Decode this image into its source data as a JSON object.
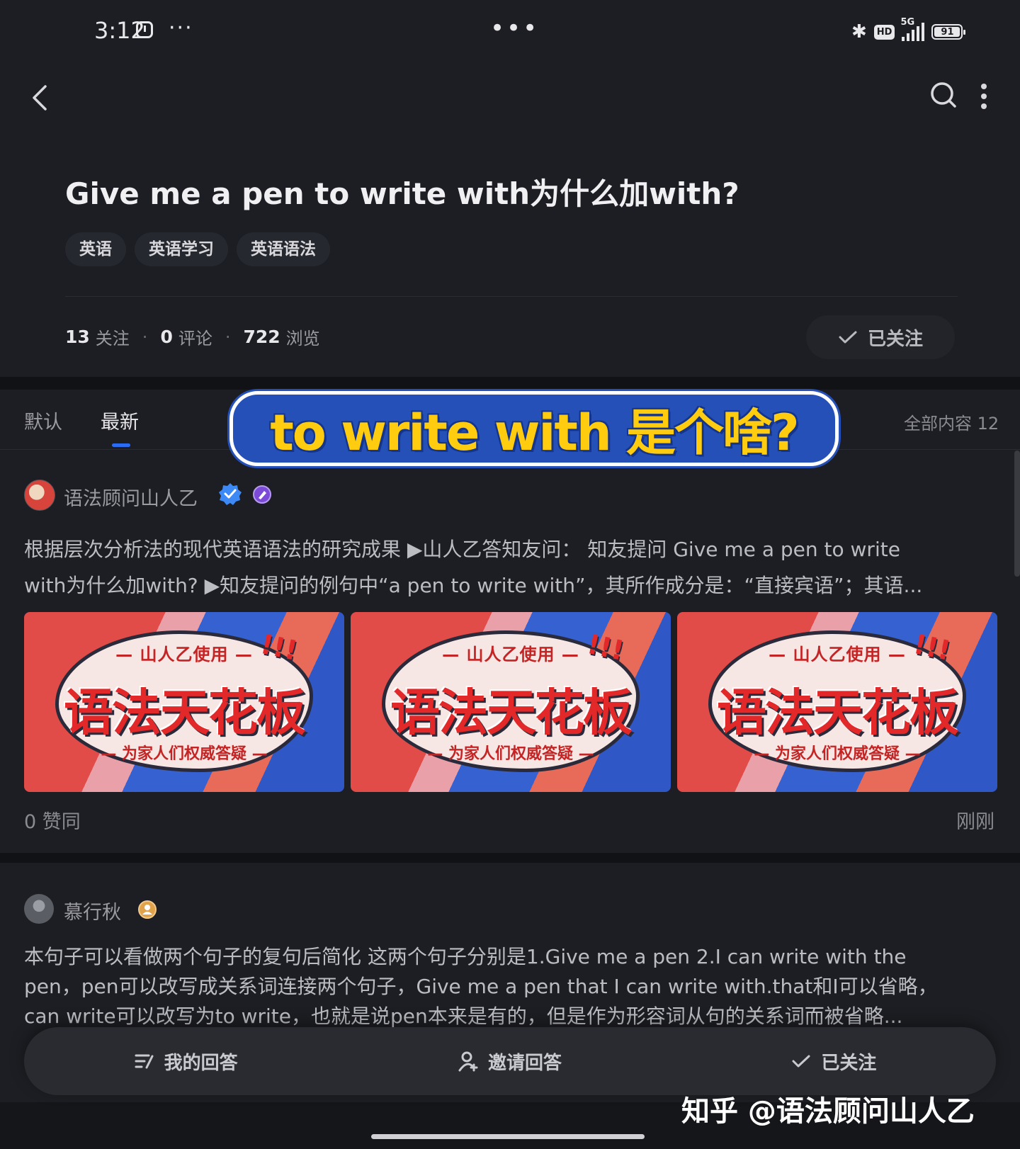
{
  "status_bar": {
    "time": "3:12",
    "overflow_dots": "···",
    "center_dots": "•••",
    "network": "5G",
    "hd": "HD",
    "battery": "91"
  },
  "question": {
    "title": "Give me a pen to write with为什么加with?",
    "tags": [
      "英语",
      "英语学习",
      "英语语法"
    ],
    "follow_count": "13",
    "follow_label": "关注",
    "comment_count": "0",
    "comment_label": "评论",
    "view_count": "722",
    "view_label": "浏览",
    "follow_button": "已关注"
  },
  "tabs": {
    "default": "默认",
    "latest": "最新",
    "total": "全部内容 12"
  },
  "overlay_caption": "to write with 是个啥?",
  "answers": [
    {
      "author": "语法顾问山人乙",
      "excerpt_line1": "根据层次分析法的现代英语语法的研究成果 ▶山人乙答知友问： 知友提问 Give me a pen to write",
      "excerpt_line2": "with为什么加with? ▶知友提问的例句中“a pen to write with”，其所作成分是：“直接宾语”；其语...",
      "images": [
        {
          "top": "— 山人乙使用 —",
          "main": "语法天花板",
          "sub": "— 为家人们权威答疑 —",
          "excl": "!!!"
        },
        {
          "top": "— 山人乙使用 —",
          "main": "语法天花板",
          "sub": "— 为家人们权威答疑 —",
          "excl": "!!!"
        },
        {
          "top": "— 山人乙使用 —",
          "main": "语法天花板",
          "sub": "— 为家人们权威答疑 —",
          "excl": "!!!"
        }
      ],
      "likes": "0 赞同",
      "time": "刚刚"
    },
    {
      "author": "慕行秋",
      "excerpt_line1": "本句子可以看做两个句子的复句后简化 这两个句子分别是1.Give me a pen 2.I can write with the",
      "excerpt_line2": "pen，pen可以改写成关系词连接两个句子，Give me a pen that I can write with.that和I可以省略，",
      "excerpt_line3": "can write可以改写为to write，也就是说pen本来是有的，但是作为形容词从句的关系词而被省略..."
    }
  ],
  "bottom_bar": {
    "my_answer": "我的回答",
    "invite": "邀请回答",
    "followed": "已关注"
  },
  "watermark": "知乎 @语法顾问山人乙",
  "colors": {
    "background": "#1d1e23",
    "accent_blue": "#2a6df4",
    "caption_yellow": "#ffcc10",
    "caption_blue": "#2450b8"
  }
}
